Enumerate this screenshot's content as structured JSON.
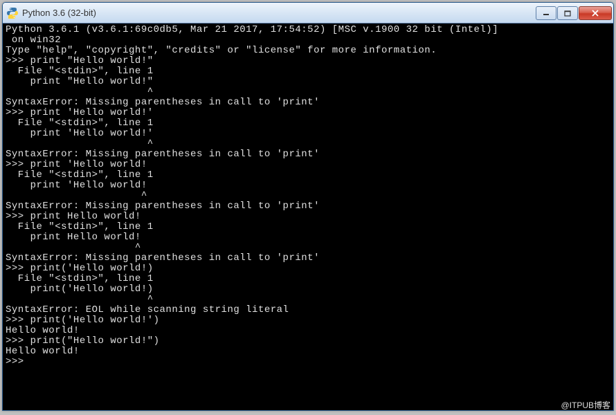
{
  "window": {
    "title": "Python 3.6 (32-bit)",
    "icon": "python-icon"
  },
  "terminal": {
    "lines": [
      "Python 3.6.1 (v3.6.1:69c0db5, Mar 21 2017, 17:54:52) [MSC v.1900 32 bit (Intel)]",
      " on win32",
      "Type \"help\", \"copyright\", \"credits\" or \"license\" for more information.",
      ">>> print \"Hello world!\"",
      "  File \"<stdin>\", line 1",
      "    print \"Hello world!\"",
      "                       ^",
      "SyntaxError: Missing parentheses in call to 'print'",
      ">>> print 'Hello world!'",
      "  File \"<stdin>\", line 1",
      "    print 'Hello world!'",
      "                       ^",
      "SyntaxError: Missing parentheses in call to 'print'",
      ">>> print 'Hello world!",
      "  File \"<stdin>\", line 1",
      "    print 'Hello world!",
      "                      ^",
      "SyntaxError: Missing parentheses in call to 'print'",
      ">>> print Hello world!",
      "  File \"<stdin>\", line 1",
      "    print Hello world!",
      "                     ^",
      "SyntaxError: Missing parentheses in call to 'print'",
      ">>> print('Hello world!)",
      "  File \"<stdin>\", line 1",
      "    print('Hello world!)",
      "                       ^",
      "SyntaxError: EOL while scanning string literal",
      ">>> print('Hello world!')",
      "Hello world!",
      ">>> print(\"Hello world!\")",
      "Hello world!",
      ">>> "
    ]
  },
  "watermark": "@ITPUB博客"
}
